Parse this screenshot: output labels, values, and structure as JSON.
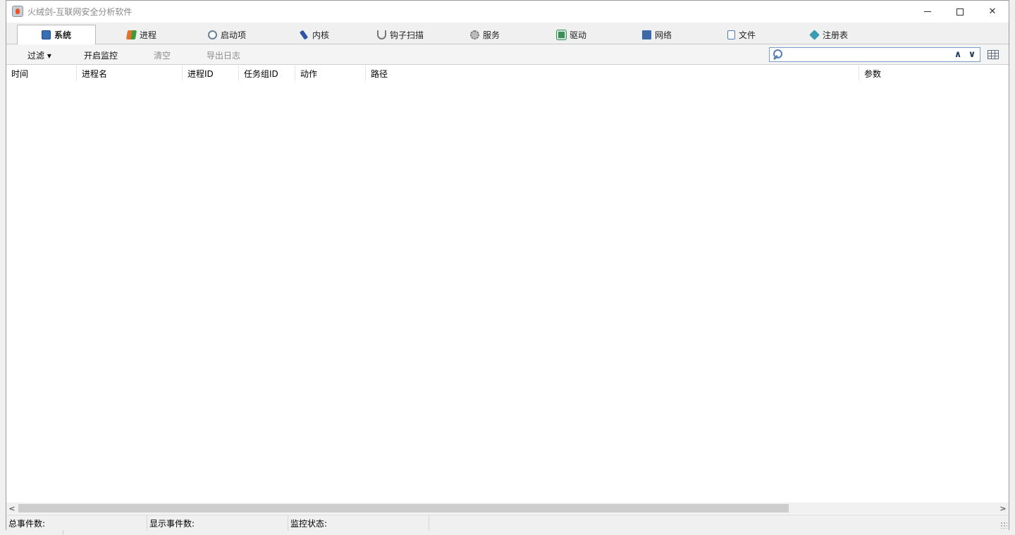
{
  "window": {
    "title": "火绒剑-互联网安全分析软件"
  },
  "tabs": [
    {
      "label": "系统",
      "icon": "monitor-icon",
      "color": "#3b6fb5",
      "active": true
    },
    {
      "label": "进程",
      "icon": "windows-flag-icon",
      "color": "#e0722a"
    },
    {
      "label": "启动项",
      "icon": "gear-eye-icon",
      "color": "#6d7f99"
    },
    {
      "label": "内核",
      "icon": "wrench-icon",
      "color": "#2e57a8"
    },
    {
      "label": "钩子扫描",
      "icon": "hook-icon",
      "color": "#7a7a7a"
    },
    {
      "label": "服务",
      "icon": "service-gear-icon",
      "color": "#8a8a8a"
    },
    {
      "label": "驱动",
      "icon": "chip-icon",
      "color": "#3e8e5c"
    },
    {
      "label": "网络",
      "icon": "network-icon",
      "color": "#3c6aa8"
    },
    {
      "label": "文件",
      "icon": "file-icon",
      "color": "#4a78b8"
    },
    {
      "label": "注册表",
      "icon": "registry-icon",
      "color": "#3c9bb0"
    }
  ],
  "toolbar": {
    "filter": "过滤 ▾",
    "start_monitor": "开启监控",
    "clear": "清空",
    "export_log": "导出日志",
    "search_placeholder": "",
    "up": "∧",
    "down": "∨"
  },
  "columns": [
    {
      "label": "时间"
    },
    {
      "label": "进程名"
    },
    {
      "label": "进程ID"
    },
    {
      "label": "任务组ID"
    },
    {
      "label": "动作"
    },
    {
      "label": "路径"
    },
    {
      "label": "参数"
    }
  ],
  "scroll": {
    "left": "<",
    "right": ">"
  },
  "status": {
    "total_events": "总事件数:",
    "shown_events": "显示事件数:",
    "monitor_state": "监控状态:"
  }
}
